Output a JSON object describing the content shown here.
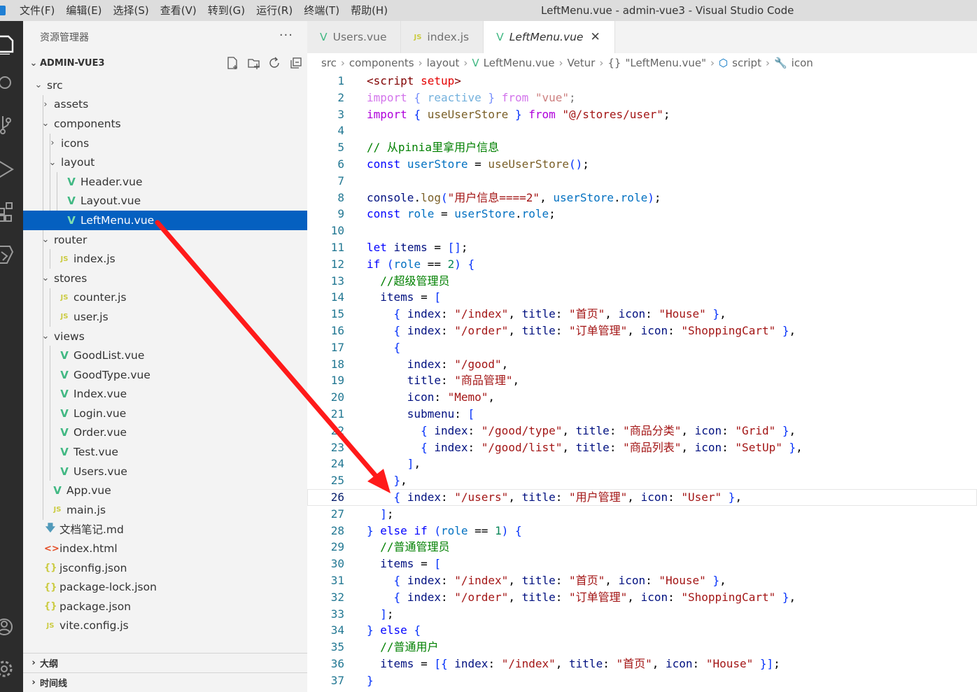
{
  "window": {
    "title": "LeftMenu.vue - admin-vue3 - Visual Studio Code",
    "menu": [
      "文件(F)",
      "编辑(E)",
      "选择(S)",
      "查看(V)",
      "转到(G)",
      "运行(R)",
      "终端(T)",
      "帮助(H)"
    ]
  },
  "activity_bar": [
    "explorer-icon",
    "search-icon",
    "source-control-icon",
    "run-debug-icon",
    "extensions-icon",
    "remote-icon",
    "account-icon",
    "settings-icon"
  ],
  "sidebar": {
    "title": "资源管理器",
    "more": "···",
    "project": "ADMIN-VUE3",
    "tree": [
      {
        "label": "src",
        "type": "folder-open",
        "depth": 1
      },
      {
        "label": "assets",
        "type": "folder-closed",
        "depth": 2
      },
      {
        "label": "components",
        "type": "folder-open",
        "depth": 2
      },
      {
        "label": "icons",
        "type": "folder-closed",
        "depth": 3
      },
      {
        "label": "layout",
        "type": "folder-open",
        "depth": 3
      },
      {
        "label": "Header.vue",
        "type": "vue",
        "depth": 4
      },
      {
        "label": "Layout.vue",
        "type": "vue",
        "depth": 4
      },
      {
        "label": "LeftMenu.vue",
        "type": "vue",
        "depth": 4,
        "selected": true
      },
      {
        "label": "router",
        "type": "folder-open",
        "depth": 2
      },
      {
        "label": "index.js",
        "type": "js",
        "depth": 3
      },
      {
        "label": "stores",
        "type": "folder-open",
        "depth": 2
      },
      {
        "label": "counter.js",
        "type": "js",
        "depth": 3
      },
      {
        "label": "user.js",
        "type": "js",
        "depth": 3
      },
      {
        "label": "views",
        "type": "folder-open",
        "depth": 2
      },
      {
        "label": "GoodList.vue",
        "type": "vue",
        "depth": 3
      },
      {
        "label": "GoodType.vue",
        "type": "vue",
        "depth": 3
      },
      {
        "label": "Index.vue",
        "type": "vue",
        "depth": 3
      },
      {
        "label": "Login.vue",
        "type": "vue",
        "depth": 3
      },
      {
        "label": "Order.vue",
        "type": "vue",
        "depth": 3
      },
      {
        "label": "Test.vue",
        "type": "vue",
        "depth": 3
      },
      {
        "label": "Users.vue",
        "type": "vue",
        "depth": 3
      },
      {
        "label": "App.vue",
        "type": "vue",
        "depth": 2
      },
      {
        "label": "main.js",
        "type": "js",
        "depth": 2
      },
      {
        "label": "文档笔记.md",
        "type": "md",
        "depth": 1
      },
      {
        "label": "index.html",
        "type": "html",
        "depth": 1
      },
      {
        "label": "jsconfig.json",
        "type": "json",
        "depth": 1
      },
      {
        "label": "package-lock.json",
        "type": "json",
        "depth": 1
      },
      {
        "label": "package.json",
        "type": "json",
        "depth": 1
      },
      {
        "label": "vite.config.js",
        "type": "js",
        "depth": 1
      }
    ],
    "outline": "大纲",
    "timeline": "时间线"
  },
  "tabs": [
    {
      "label": "Users.vue",
      "icon": "vue"
    },
    {
      "label": "index.js",
      "icon": "js"
    },
    {
      "label": "LeftMenu.vue",
      "icon": "vue",
      "active": true,
      "close": "✕"
    }
  ],
  "breadcrumb": [
    "src",
    "components",
    "layout",
    "LeftMenu.vue",
    "Vetur",
    "\"LeftMenu.vue\"",
    "script",
    "icon"
  ],
  "code_lines": [
    "<script setup>",
    "import { reactive } from \"vue\";",
    "import { useUserStore } from \"@/stores/user\";",
    "",
    "// 从pinia里拿用户信息",
    "const userStore = useUserStore();",
    "",
    "console.log(\"用户信息====2\", userStore.role);",
    "const role = userStore.role;",
    "",
    "let items = [];",
    "if (role == 2) {",
    "  //超级管理员",
    "  items = [",
    "    { index: \"/index\", title: \"首页\", icon: \"House\" },",
    "    { index: \"/order\", title: \"订单管理\", icon: \"ShoppingCart\" },",
    "    {",
    "      index: \"/good\",",
    "      title: \"商品管理\",",
    "      icon: \"Memo\",",
    "      submenu: [",
    "        { index: \"/good/type\", title: \"商品分类\", icon: \"Grid\" },",
    "        { index: \"/good/list\", title: \"商品列表\", icon: \"SetUp\" },",
    "      ],",
    "    },",
    "    { index: \"/users\", title: \"用户管理\", icon: \"User\" },",
    "  ];",
    "} else if (role == 1) {",
    "  //普通管理员",
    "  items = [",
    "    { index: \"/index\", title: \"首页\", icon: \"House\" },",
    "    { index: \"/order\", title: \"订单管理\", icon: \"ShoppingCart\" },",
    "  ];",
    "} else {",
    "  //普通用户",
    "  items = [{ index: \"/index\", title: \"首页\", icon: \"House\" }];",
    "}"
  ],
  "current_line": 26,
  "colors": {
    "selection": "#0560c0",
    "annotation_arrow": "#ff1a1a",
    "vue_icon": "#41b883",
    "js_icon": "#cbcb41"
  }
}
